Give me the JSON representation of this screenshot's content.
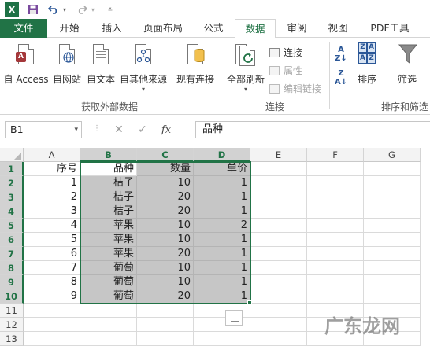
{
  "ribbon_tabs": [
    "文件",
    "开始",
    "插入",
    "页面布局",
    "公式",
    "数据",
    "审阅",
    "视图",
    "PDF工具"
  ],
  "active_tab": "数据",
  "quick_access": {
    "app_icon": "excel-icon",
    "items": [
      "save-icon",
      "undo-icon",
      "redo-icon",
      "customize-icon"
    ]
  },
  "groups": {
    "external": {
      "label": "获取外部数据",
      "buttons": [
        "自 Access",
        "自网站",
        "自文本",
        "自其他来源"
      ]
    },
    "existing": {
      "label": "现有连接"
    },
    "connections": {
      "label": "连接",
      "refresh": "全部刷新",
      "small": [
        "连接",
        "属性",
        "编辑链接"
      ]
    },
    "sort": {
      "label": "排序和筛选",
      "sort_btn": "排序",
      "filter_btn": "筛选"
    }
  },
  "formula_bar": {
    "name_box": "B1",
    "fx": "fx",
    "formula": "品种"
  },
  "columns": [
    "A",
    "B",
    "C",
    "D",
    "E",
    "F",
    "G"
  ],
  "rows": [
    "1",
    "2",
    "3",
    "4",
    "5",
    "6",
    "7",
    "8",
    "9",
    "10",
    "11",
    "12",
    "13"
  ],
  "table": {
    "header": [
      "序号",
      "品种",
      "数量",
      "单价"
    ],
    "data": [
      [
        "1",
        "桔子",
        "10",
        "1"
      ],
      [
        "2",
        "桔子",
        "20",
        "1"
      ],
      [
        "3",
        "桔子",
        "20",
        "1"
      ],
      [
        "4",
        "苹果",
        "10",
        "2"
      ],
      [
        "5",
        "苹果",
        "10",
        "1"
      ],
      [
        "6",
        "苹果",
        "20",
        "1"
      ],
      [
        "7",
        "葡萄",
        "10",
        "1"
      ],
      [
        "8",
        "葡萄",
        "10",
        "1"
      ],
      [
        "9",
        "葡萄",
        "20",
        "1"
      ]
    ]
  },
  "watermark": "广东龙网",
  "colors": {
    "excel_green": "#217346",
    "selection_fill": "#c6c6c6"
  }
}
